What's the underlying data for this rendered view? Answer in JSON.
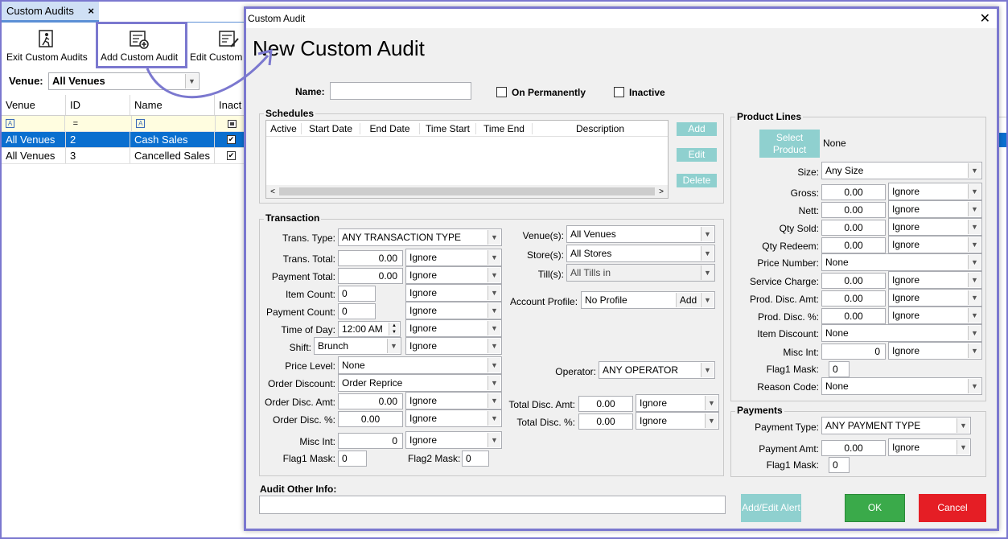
{
  "background": {
    "tab_label": "Custom Audits",
    "tab_close": "×",
    "toolbar": {
      "exit_label": "Exit Custom Audits",
      "add_label": "Add Custom Audit",
      "edit_label": "Edit Custom"
    },
    "venue_label": "Venue:",
    "venue_value": "All Venues",
    "grid": {
      "headers": [
        "Venue",
        "ID",
        "Name",
        "Inact"
      ],
      "rows": [
        {
          "venue": "All Venues",
          "id": "2",
          "name": "Cash Sales"
        },
        {
          "venue": "All Venues",
          "id": "3",
          "name": "Cancelled Sales"
        }
      ]
    }
  },
  "dialog": {
    "window_title": "Custom Audit",
    "close": "✕",
    "heading": "New Custom Audit",
    "name_label": "Name:",
    "name_value": "",
    "on_permanently_label": "On Permanently",
    "inactive_label": "Inactive",
    "schedules": {
      "title": "Schedules",
      "columns": [
        "Active",
        "Start Date",
        "End Date",
        "Time Start",
        "Time End",
        "Description"
      ],
      "add": "Add",
      "edit": "Edit",
      "delete": "Delete"
    },
    "transaction": {
      "title": "Transaction",
      "trans_type_label": "Trans. Type:",
      "trans_type": "ANY TRANSACTION TYPE",
      "trans_total_label": "Trans. Total:",
      "trans_total": "0.00",
      "trans_total_op": "Ignore",
      "payment_total_label": "Payment Total:",
      "payment_total": "0.00",
      "payment_total_op": "Ignore",
      "item_count_label": "Item Count:",
      "item_count": "0",
      "item_count_op": "Ignore",
      "payment_count_label": "Payment Count:",
      "payment_count": "0",
      "payment_count_op": "Ignore",
      "time_of_day_label": "Time of Day:",
      "time_of_day": "12:00 AM",
      "time_of_day_op": "Ignore",
      "shift_label": "Shift:",
      "shift": "Brunch",
      "shift_op": "Ignore",
      "price_level_label": "Price Level:",
      "price_level": "None",
      "order_discount_label": "Order Discount:",
      "order_discount": "Order Reprice",
      "order_disc_amt_label": "Order Disc. Amt:",
      "order_disc_amt": "0.00",
      "order_disc_amt_op": "Ignore",
      "order_disc_pct_label": "Order Disc. %:",
      "order_disc_pct": "0.00",
      "order_disc_pct_op": "Ignore",
      "misc_int_label": "Misc Int:",
      "misc_int": "0",
      "misc_int_op": "Ignore",
      "flag1_label": "Flag1 Mask:",
      "flag1": "0",
      "flag2_label": "Flag2 Mask:",
      "flag2": "0",
      "venues_label": "Venue(s):",
      "venues": "All Venues",
      "stores_label": "Store(s):",
      "stores": "All Stores",
      "tills_label": "Till(s):",
      "tills": "All Tills in",
      "account_profile_label": "Account Profile:",
      "account_profile": "No Profile",
      "account_profile_add": "Add",
      "operator_label": "Operator:",
      "operator": "ANY OPERATOR",
      "total_disc_amt_label": "Total Disc. Amt:",
      "total_disc_amt": "0.00",
      "total_disc_amt_op": "Ignore",
      "total_disc_pct_label": "Total Disc. %:",
      "total_disc_pct": "0.00",
      "total_disc_pct_op": "Ignore"
    },
    "product_lines": {
      "title": "Product Lines",
      "select_product": "Select Product",
      "selected": "None",
      "size_label": "Size:",
      "size": "Any Size",
      "gross_label": "Gross:",
      "gross": "0.00",
      "gross_op": "Ignore",
      "nett_label": "Nett:",
      "nett": "0.00",
      "nett_op": "Ignore",
      "qty_sold_label": "Qty Sold:",
      "qty_sold": "0.00",
      "qty_sold_op": "Ignore",
      "qty_redeem_label": "Qty Redeem:",
      "qty_redeem": "0.00",
      "qty_redeem_op": "Ignore",
      "price_number_label": "Price Number:",
      "price_number": "None",
      "service_charge_label": "Service Charge:",
      "service_charge": "0.00",
      "service_charge_op": "Ignore",
      "prod_disc_amt_label": "Prod. Disc. Amt:",
      "prod_disc_amt": "0.00",
      "prod_disc_amt_op": "Ignore",
      "prod_disc_pct_label": "Prod. Disc. %:",
      "prod_disc_pct": "0.00",
      "prod_disc_pct_op": "Ignore",
      "item_discount_label": "Item Discount:",
      "item_discount": "None",
      "misc_int_label": "Misc Int:",
      "misc_int": "0",
      "misc_int_op": "Ignore",
      "flag1_label": "Flag1 Mask:",
      "flag1": "0",
      "reason_code_label": "Reason Code:",
      "reason_code": "None"
    },
    "payments": {
      "title": "Payments",
      "payment_type_label": "Payment Type:",
      "payment_type": "ANY PAYMENT TYPE",
      "payment_amt_label": "Payment Amt:",
      "payment_amt": "0.00",
      "payment_amt_op": "Ignore",
      "flag1_label": "Flag1 Mask:",
      "flag1": "0"
    },
    "audit_other_info_label": "Audit Other Info:",
    "audit_other_info": "",
    "add_edit_alert": "Add/Edit Alert",
    "ok": "OK",
    "cancel": "Cancel"
  },
  "colors": {
    "highlight": "#7b78cf",
    "teal_button": "#8fd0cf",
    "ok_green": "#3aaa4a",
    "cancel_red": "#e51e25",
    "selection_blue": "#0a6fcf"
  }
}
